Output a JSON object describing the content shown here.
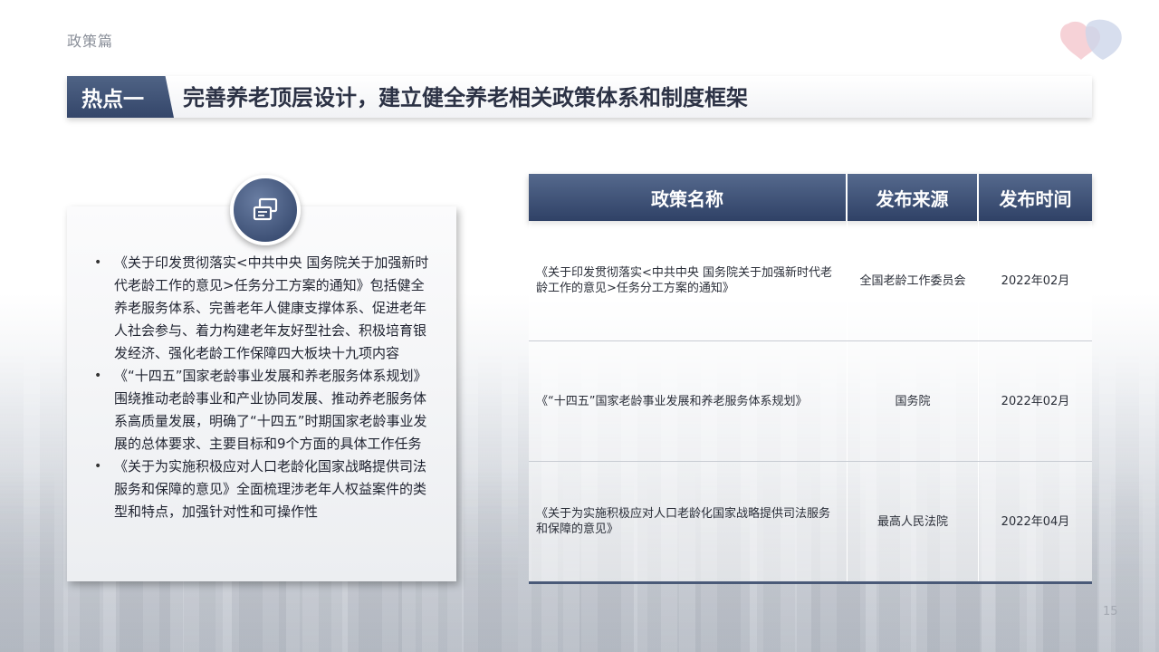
{
  "header": {
    "section_label": "政策篇",
    "hotspot_tag": "热点一",
    "title": "完善养老顶层设计，建立健全养老相关政策体系和制度框架",
    "logo_icon": "heart-logo-icon"
  },
  "info_card": {
    "icon": "documents-icon",
    "bullets": [
      "《关于印发贯彻落实<中共中央 国务院关于加强新时代老龄工作的意见>任务分工方案的通知》包括健全养老服务体系、完善老年人健康支撑体系、促进老年人社会参与、着力构建老年友好型社会、积极培育银发经济、强化老龄工作保障四大板块十九项内容",
      "《“十四五”国家老龄事业发展和养老服务体系规划》围绕推动老龄事业和产业协同发展、推动养老服务体系高质量发展，明确了“十四五”时期国家老龄事业发展的总体要求、主要目标和9个方面的具体工作任务",
      "《关于为实施积极应对人口老龄化国家战略提供司法服务和保障的意见》全面梳理涉老年人权益案件的类型和特点，加强针对性和可操作性"
    ]
  },
  "table": {
    "headers": [
      "政策名称",
      "发布来源",
      "发布时间"
    ],
    "rows": [
      {
        "name": "《关于印发贯彻落实<中共中央 国务院关于加强新时代老龄工作的意见>任务分工方案的通知》",
        "source": "全国老龄工作委员会",
        "date": "2022年02月"
      },
      {
        "name": "《“十四五”国家老龄事业发展和养老服务体系规划》",
        "source": "国务院",
        "date": "2022年02月"
      },
      {
        "name": "《关于为实施积极应对人口老龄化国家战略提供司法服务和保障的意见》",
        "source": "最高人民法院",
        "date": "2022年04月"
      }
    ]
  },
  "footer": {
    "page_number": "15"
  },
  "colors": {
    "accent": "#3c4f74",
    "title_text": "#2c3245",
    "table_bottom_rule": "#4a5a78"
  }
}
